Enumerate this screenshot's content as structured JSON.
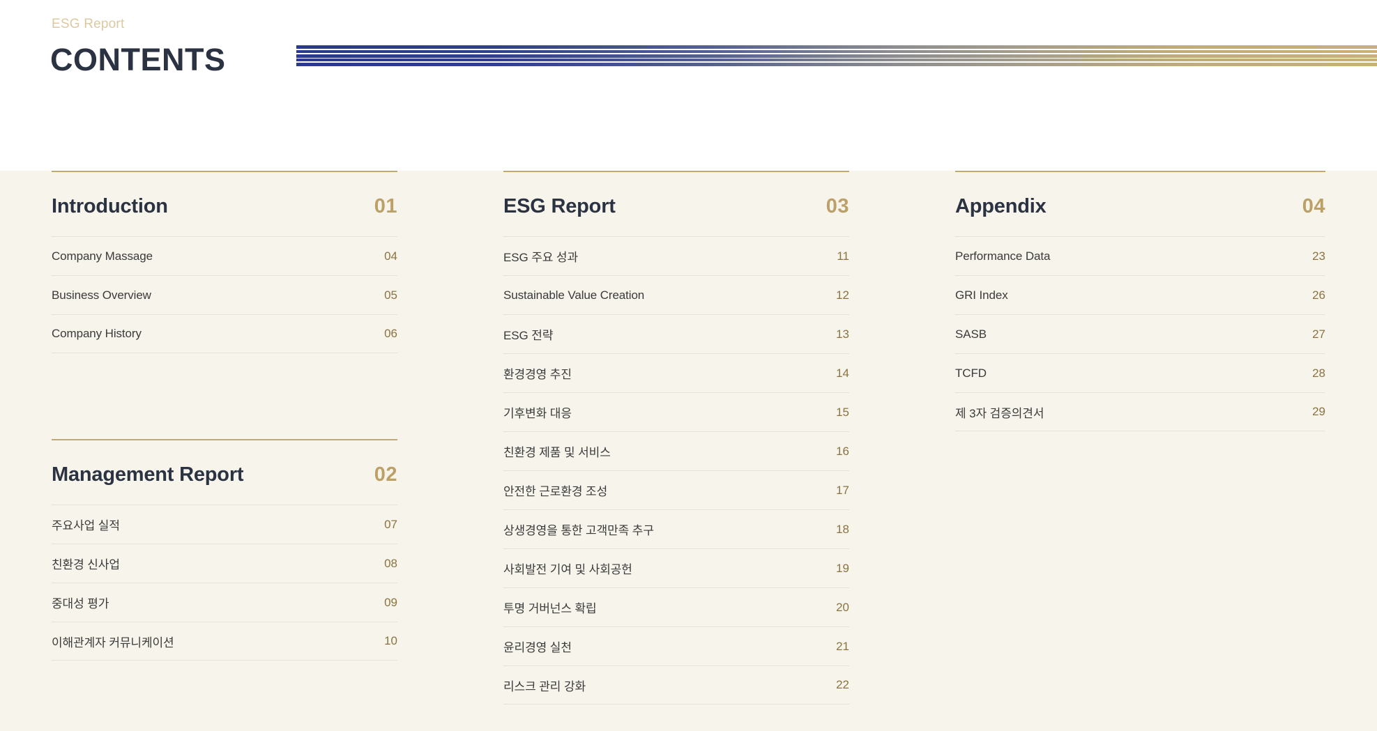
{
  "header": {
    "eyebrow": "ESG Report",
    "title": "CONTENTS",
    "decoration": {
      "name": "striped-gradient-rule",
      "stripe_count": 5,
      "gradient_start_color": "#2a3a8c",
      "gradient_end_color": "#c9b07a"
    }
  },
  "theme": {
    "page_background": "#ffffff",
    "content_background": "#f7f4ec",
    "gold": "#c3a971",
    "gold_number": "#bca068",
    "gold_page": "#8a7340",
    "eyebrow_gold": "#ddc9a0",
    "navy_text": "#2b3342",
    "row_divider": "#e6e2d6"
  },
  "columns": [
    {
      "id": "column-1",
      "sections": [
        {
          "id": "introduction",
          "title": "Introduction",
          "number": "01",
          "items": [
            {
              "label": "Company Massage",
              "page": "04"
            },
            {
              "label": "Business Overview",
              "page": "05"
            },
            {
              "label": "Company History",
              "page": "06"
            }
          ]
        },
        {
          "id": "management-report",
          "title": "Management Report",
          "number": "02",
          "items": [
            {
              "label": "주요사업 실적",
              "page": "07"
            },
            {
              "label": "친환경 신사업",
              "page": "08"
            },
            {
              "label": "중대성 평가",
              "page": "09"
            },
            {
              "label": "이해관계자 커뮤니케이션",
              "page": "10"
            }
          ]
        }
      ]
    },
    {
      "id": "column-2",
      "sections": [
        {
          "id": "esg-report",
          "title": "ESG Report",
          "number": "03",
          "items": [
            {
              "label": "ESG 주요 성과",
              "page": "11"
            },
            {
              "label": "Sustainable Value Creation",
              "page": "12"
            },
            {
              "label": "ESG 전략",
              "page": "13"
            },
            {
              "label": "환경경영 추진",
              "page": "14"
            },
            {
              "label": "기후변화 대응",
              "page": "15"
            },
            {
              "label": "친환경 제품 및 서비스",
              "page": "16"
            },
            {
              "label": "안전한 근로환경 조성",
              "page": "17"
            },
            {
              "label": "상생경영을 통한 고객만족 추구",
              "page": "18"
            },
            {
              "label": "사회발전 기여 및 사회공헌",
              "page": "19"
            },
            {
              "label": "투명 거버넌스 확립",
              "page": "20"
            },
            {
              "label": "윤리경영 실천",
              "page": "21"
            },
            {
              "label": "리스크 관리 강화",
              "page": "22"
            }
          ]
        }
      ]
    },
    {
      "id": "column-3",
      "sections": [
        {
          "id": "appendix",
          "title": "Appendix",
          "number": "04",
          "items": [
            {
              "label": "Performance Data",
              "page": "23"
            },
            {
              "label": "GRI Index",
              "page": "26"
            },
            {
              "label": "SASB",
              "page": "27"
            },
            {
              "label": "TCFD",
              "page": "28"
            },
            {
              "label": "제 3자 검증의견서",
              "page": "29"
            }
          ]
        }
      ]
    }
  ]
}
